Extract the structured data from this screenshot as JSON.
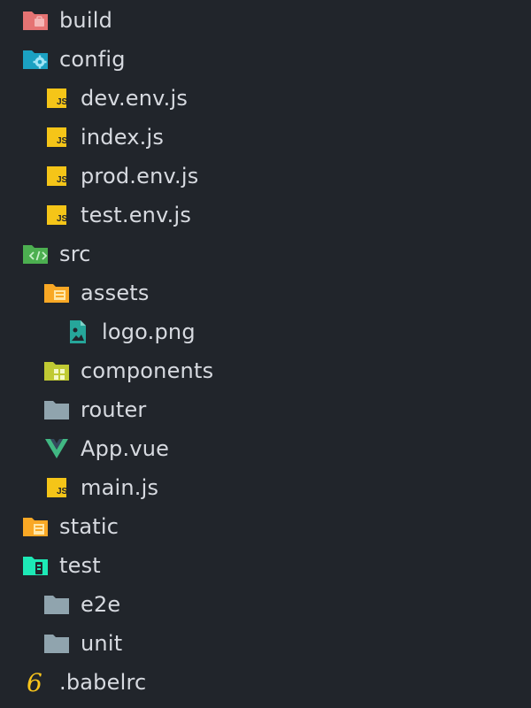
{
  "tree": {
    "items": [
      {
        "label": "build",
        "icon": "folder-build-icon",
        "level": 0
      },
      {
        "label": "config",
        "icon": "folder-config-icon",
        "level": 0
      },
      {
        "label": "dev.env.js",
        "icon": "javascript-file-icon",
        "level": 1
      },
      {
        "label": "index.js",
        "icon": "javascript-file-icon",
        "level": 1
      },
      {
        "label": "prod.env.js",
        "icon": "javascript-file-icon",
        "level": 1
      },
      {
        "label": "test.env.js",
        "icon": "javascript-file-icon",
        "level": 1
      },
      {
        "label": "src",
        "icon": "folder-src-icon",
        "level": 0
      },
      {
        "label": "assets",
        "icon": "folder-assets-icon",
        "level": 1
      },
      {
        "label": "logo.png",
        "icon": "image-file-icon",
        "level": 2
      },
      {
        "label": "components",
        "icon": "folder-components-icon",
        "level": 1
      },
      {
        "label": "router",
        "icon": "folder-icon",
        "level": 1
      },
      {
        "label": "App.vue",
        "icon": "vue-file-icon",
        "level": 1
      },
      {
        "label": "main.js",
        "icon": "javascript-file-icon",
        "level": 1
      },
      {
        "label": "static",
        "icon": "folder-static-icon",
        "level": 0
      },
      {
        "label": "test",
        "icon": "folder-test-icon",
        "level": 0
      },
      {
        "label": "e2e",
        "icon": "folder-icon",
        "level": 1
      },
      {
        "label": "unit",
        "icon": "folder-icon",
        "level": 1
      },
      {
        "label": ".babelrc",
        "icon": "babel-file-icon",
        "level": 0
      }
    ]
  },
  "colors": {
    "background": "#21252b",
    "text": "#d7dae0",
    "js_yellow": "#f5c518",
    "build_red": "#e57373",
    "config_teal": "#1ba1c2",
    "src_green": "#4caf50",
    "assets_yellow": "#f9a825",
    "image_teal": "#26a69a",
    "components_lime": "#c0ca33",
    "folder_gray": "#90a4ae",
    "vue_green": "#41b883",
    "test_teal": "#1de9b6",
    "babel_yellow": "#f9c51b"
  }
}
